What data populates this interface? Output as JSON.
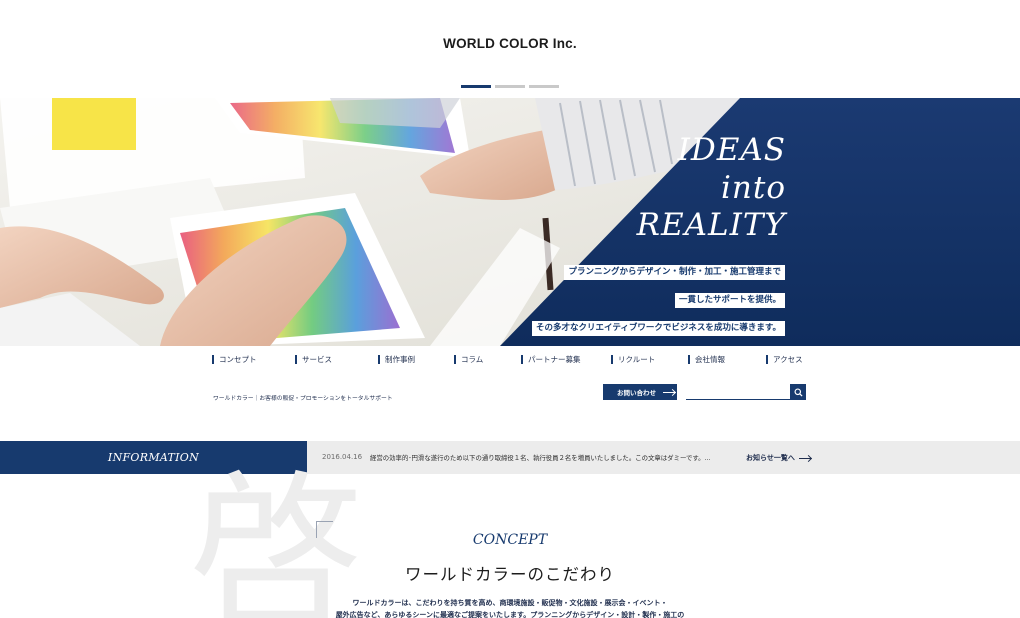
{
  "header": {
    "logo": "WORLD COLOR Inc.",
    "slider_dots": 3
  },
  "hero": {
    "tagline": [
      "IDEAS",
      "into",
      "REALITY"
    ],
    "copy_lines": [
      "プランニングからデザイン・制作・加工・施工管理まで",
      "一貫したサポートを提供。",
      "その多才なクリエイティブワークでビジネスを成功に導きます。"
    ]
  },
  "nav": {
    "items": [
      "コンセプト",
      "サービス",
      "制作事例",
      "コラム",
      "パートナー募集",
      "リクルート",
      "会社情報",
      "アクセス"
    ]
  },
  "subheader": {
    "tagline": "ワールドカラー｜お客様の販促・プロモーションをトータルサポート",
    "contact_label": "お問い合わせ",
    "search_placeholder": ""
  },
  "info": {
    "label": "INFORMATION",
    "date": "2016.04.16",
    "text": "経営の効率的･円滑な遂行のため以下の通り取締役１名、執行役員２名を増員いたしました。この文章はダミーです。...",
    "more_label": "お知らせ一覧へ"
  },
  "concept": {
    "bg_char": "啓",
    "title_en": "CONCEPT",
    "title_jp": "ワールドカラーのこだわり",
    "body_lines": [
      "ワールドカラーは、こだわりを持ち質を高め、商環境施設・販促物・文化施設・展示会・イベント・",
      "屋外広告など、あらゆるシーンに最適なご提案をいたします。プランニングからデザイン・設計・製作・施工の"
    ]
  },
  "colors": {
    "brand_navy": "#173a6e",
    "info_bg": "#ececec"
  }
}
